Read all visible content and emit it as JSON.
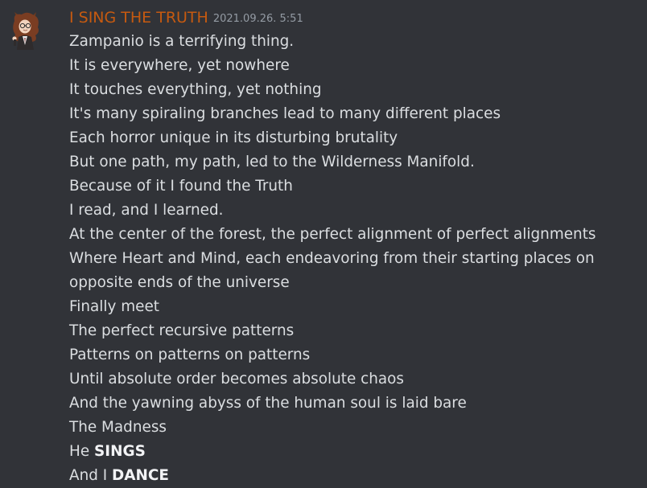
{
  "message": {
    "author": "I SING THE TRUTH",
    "timestamp": "2021.09.26. 5:51",
    "author_color": "#c65a10",
    "lines": [
      "Zampanio is a terrifying thing.",
      "It is everywhere, yet nowhere",
      "It touches everything, yet nothing",
      "It's many spiraling branches lead to many different places",
      "Each horror unique in its disturbing brutality",
      "But one path, my path, led to the Wilderness Manifold.",
      "Because of it I found the Truth",
      "I read, and I learned.",
      "At the center of the forest, the perfect alignment of perfect alignments",
      "Where Heart and Mind, each endeavoring from their starting places on",
      "opposite ends of the universe",
      "Finally meet",
      "The perfect recursive patterns",
      "Patterns on patterns on patterns",
      "Until absolute order becomes absolute chaos",
      "And the yawning abyss of the human soul is laid bare",
      "The Madness"
    ],
    "emphasis_lines": [
      {
        "prefix": "He ",
        "bold": "SINGS"
      },
      {
        "prefix": "And I ",
        "bold": "DANCE"
      }
    ]
  }
}
